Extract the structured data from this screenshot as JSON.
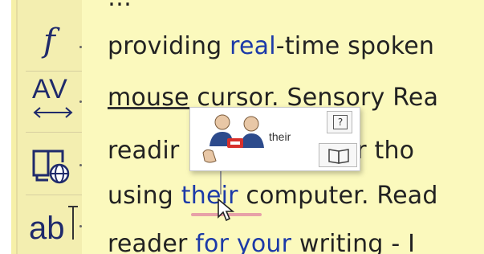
{
  "toolbar": {
    "font_glyph": "f",
    "spacing_glyph": "AV",
    "spell_glyph": "ab"
  },
  "document": {
    "line0": "…",
    "line1_pre": "providing ",
    "line1_hl": "real",
    "line1_post": "-time spoken",
    "line2_a": "mouse cursor",
    "line2_b": ". Sensory Rea",
    "line3_a": "readir",
    "line3_b": "es or tho",
    "line4_pre": "using ",
    "line4_hl": "their",
    "line4_post": " computer. Read",
    "line5_pre": "reader ",
    "line5_hl": "for your",
    "line5_post": " writing - I"
  },
  "popup": {
    "word": "their",
    "help_label": "?"
  },
  "colors": {
    "highlight": "#1c3aa8",
    "doc_bg": "#fbf9bd",
    "spell_underline": "#e7a1a8"
  }
}
